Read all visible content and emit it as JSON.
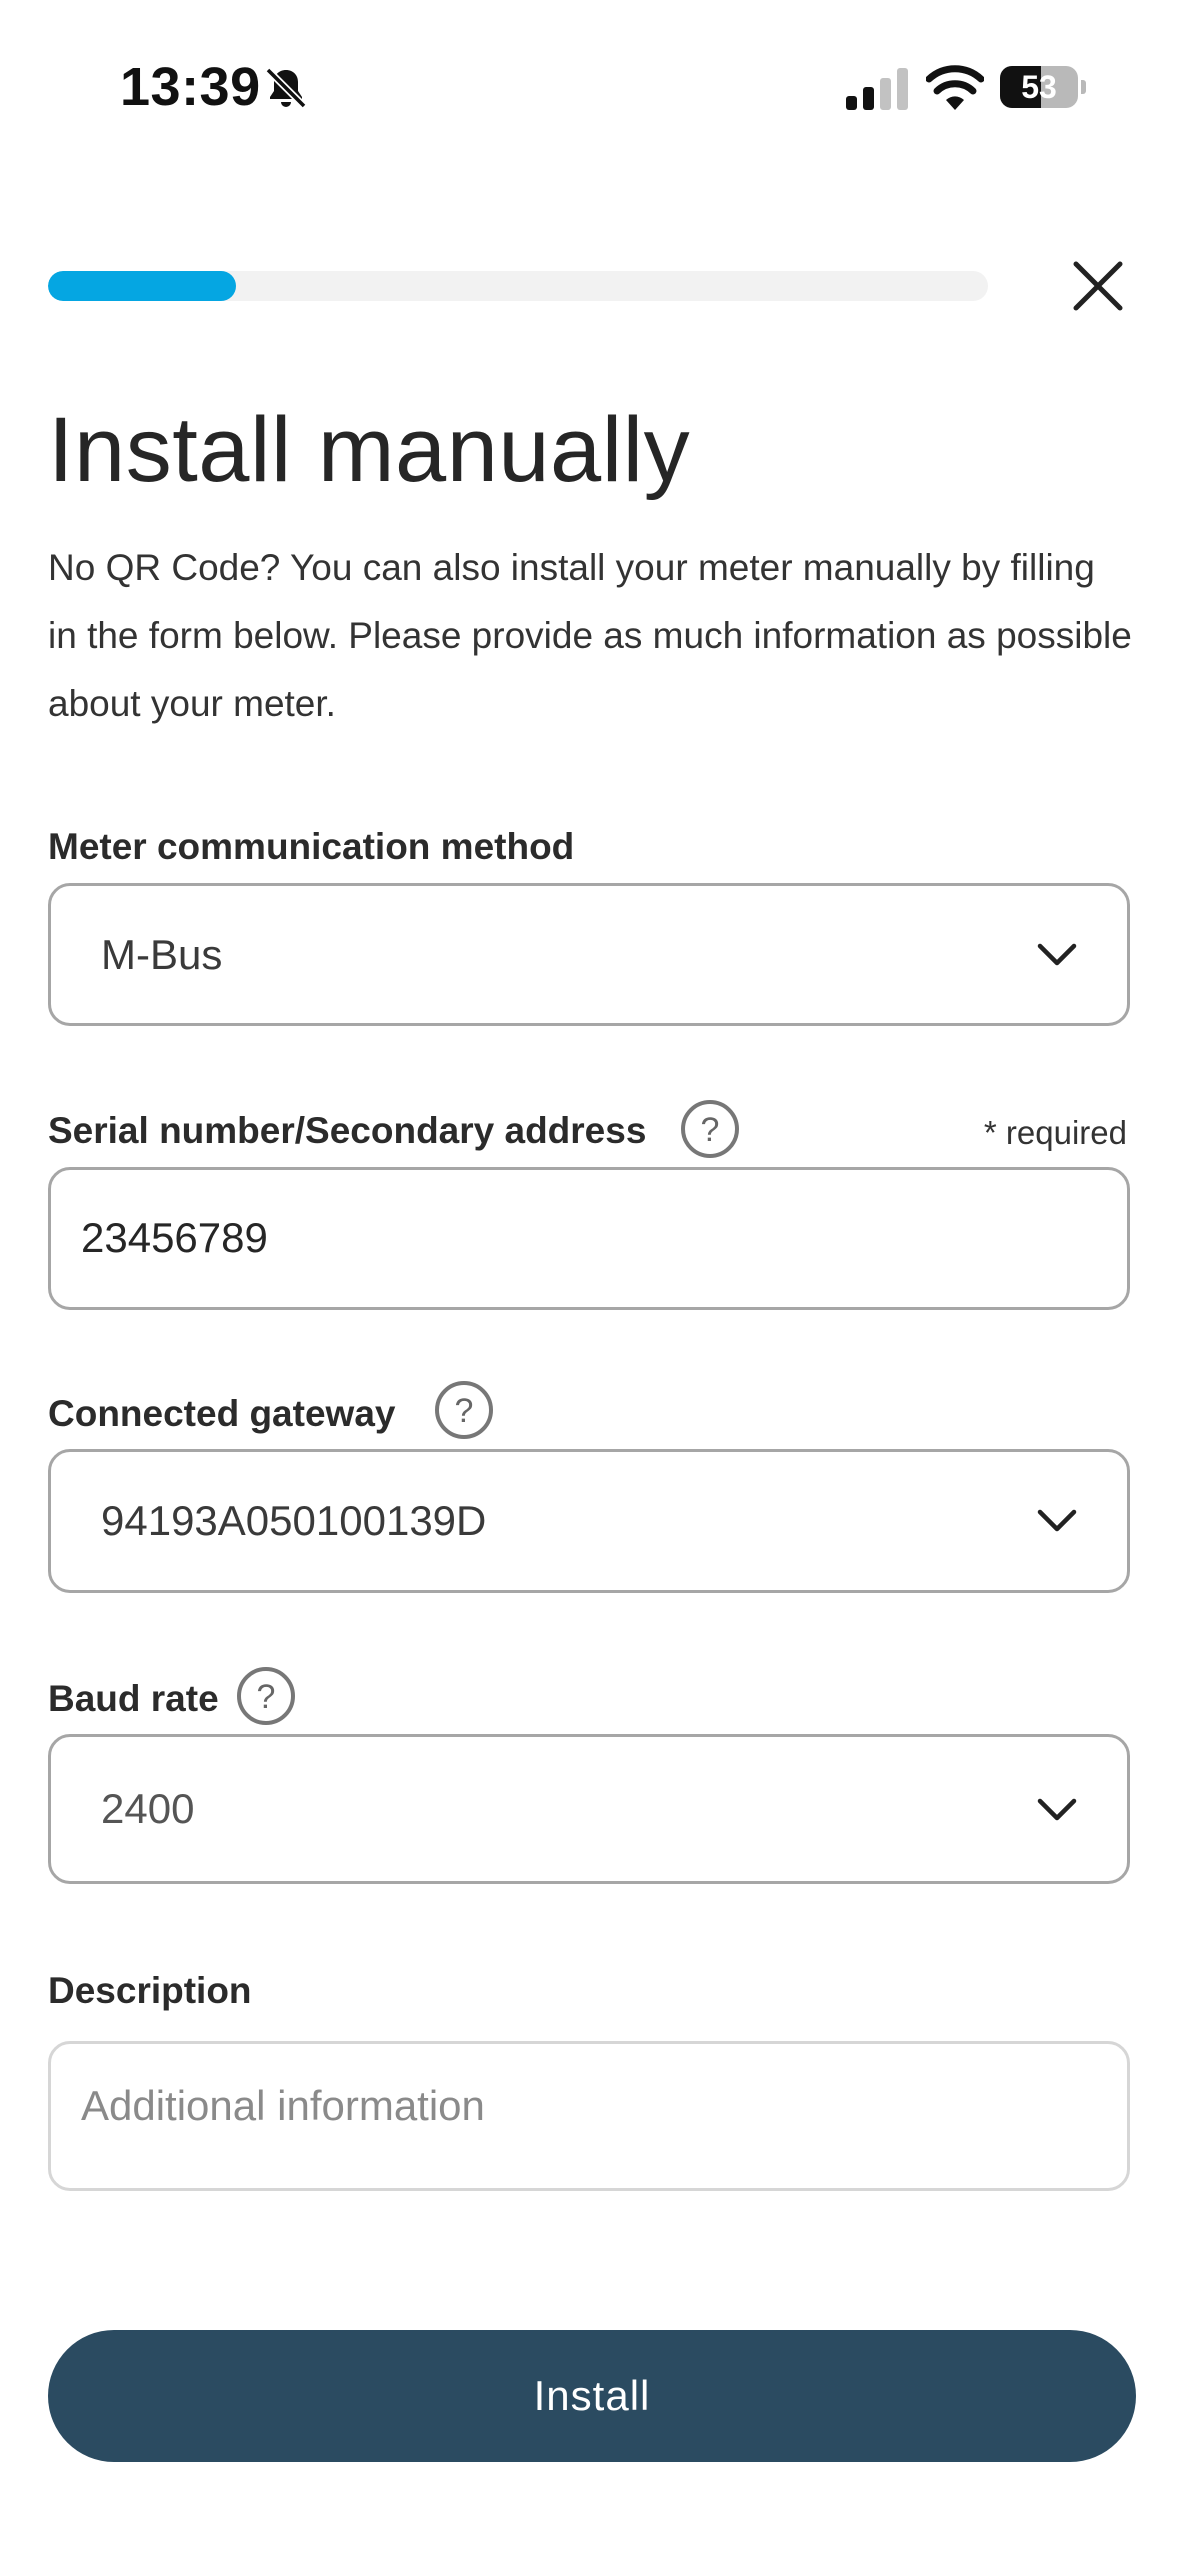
{
  "status_bar": {
    "time": "13:39",
    "battery_level": "53",
    "battery_fraction": 0.53,
    "icons": [
      "bell-slash-icon",
      "cellular-signal-icon",
      "wifi-icon",
      "battery-icon"
    ]
  },
  "progress": {
    "fraction": 0.2
  },
  "header": {
    "title": "Install manually",
    "intro": "No QR Code? You can also install your meter manually by filling in the form below. Please provide as much information as possible about your meter."
  },
  "form": {
    "communication_method": {
      "label": "Meter communication method",
      "value": "M-Bus"
    },
    "serial_number": {
      "label": "Serial number/Secondary address",
      "required_note": "* required",
      "value": "23456789"
    },
    "gateway": {
      "label": "Connected gateway",
      "value": "94193A050100139D"
    },
    "baud_rate": {
      "label": "Baud rate",
      "value": "2400"
    },
    "description": {
      "label": "Description",
      "placeholder": "Additional information"
    }
  },
  "actions": {
    "install_label": "Install"
  },
  "colors": {
    "accent": "#05a6e2",
    "primary_button": "#2b4b61",
    "progress_track": "#f2f2f2",
    "field_border": "#a6a6a6"
  }
}
